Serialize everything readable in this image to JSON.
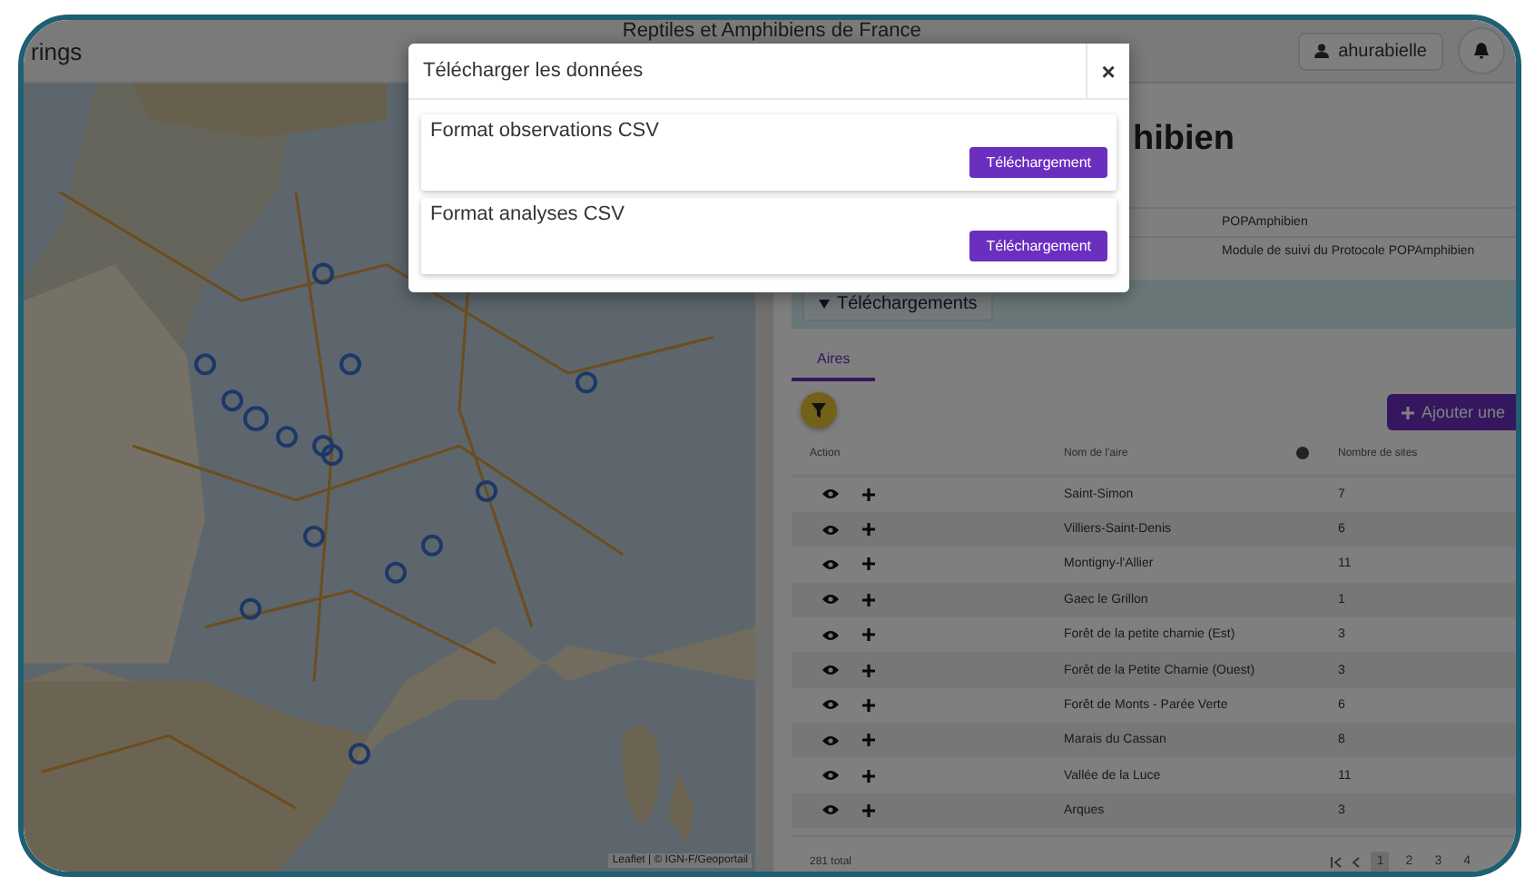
{
  "topbar": {
    "app_name": "rings",
    "title": "Reptiles et Amphibiens de France",
    "user": "ahurabielle"
  },
  "map": {
    "kind": "picture",
    "attribution": "Leaflet | © IGN-F/Geoportail"
  },
  "module": {
    "title": "hibien",
    "properties": [
      "POPAmphibien",
      "Module de suivi du Protocole POPAmphibien"
    ],
    "download_button": "Téléchargements"
  },
  "tabs": [
    {
      "label": "Aires",
      "selected": true
    }
  ],
  "add_button": "Ajouter une",
  "table": {
    "columns": [
      "Action",
      "Nom de l'aire",
      "Nombre de sites"
    ],
    "rows": [
      {
        "name": "Saint-Simon",
        "sites": "7"
      },
      {
        "name": "Villiers-Saint-Denis",
        "sites": "6"
      },
      {
        "name": "Montigny-l'Allier",
        "sites": "11"
      },
      {
        "name": "Gaec le Grillon",
        "sites": "1"
      },
      {
        "name": "Forêt de la petite charnie (Est)",
        "sites": "3"
      },
      {
        "name": "Forêt de la Petite Charnie (Ouest)",
        "sites": "3"
      },
      {
        "name": "Forêt de Monts - Parée Verte",
        "sites": "6"
      },
      {
        "name": "Marais du Cassan",
        "sites": "8"
      },
      {
        "name": "Vallée de la Luce",
        "sites": "11"
      },
      {
        "name": "Arques",
        "sites": "3"
      }
    ]
  },
  "footer": {
    "total": "281 total",
    "pages": [
      {
        "label": "1",
        "selected": true
      },
      {
        "label": "2",
        "selected": false
      },
      {
        "label": "3",
        "selected": false
      },
      {
        "label": "4",
        "selected": false
      }
    ]
  },
  "modal": {
    "title": "Télécharger les données",
    "close": "×",
    "sections": [
      {
        "title": "Format observations CSV",
        "button": "Téléchargement"
      },
      {
        "title": "Format analyses CSV",
        "button": "Téléchargement"
      }
    ]
  }
}
